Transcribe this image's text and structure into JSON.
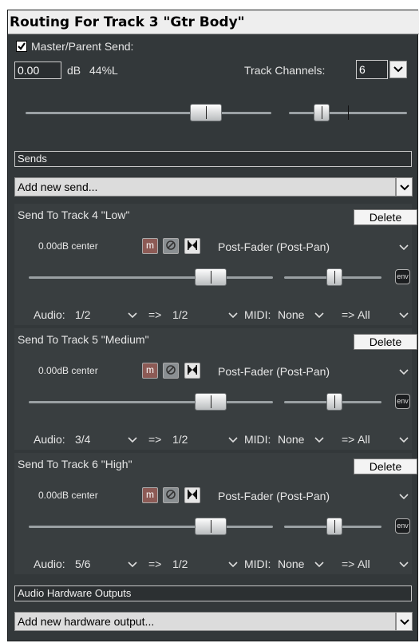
{
  "window": {
    "title": "Routing For Track 3 \"Gtr Body\""
  },
  "master": {
    "checkbox_label": "Master/Parent Send:",
    "checked": true,
    "volume_value": "0.00",
    "volume_unit": "dB",
    "pan_text": "44%L",
    "track_channels_label": "Track Channels:",
    "track_channels_value": "6"
  },
  "sends_section": {
    "header": "Sends",
    "add_new": "Add new send...",
    "sends": [
      {
        "title": "Send To Track 4 \"Low\"",
        "delete_label": "Delete",
        "level_text": "0.00dB center",
        "mode": "Post-Fader (Post-Pan)",
        "audio_label": "Audio:",
        "audio_src": "1/2",
        "arrow": "=>",
        "audio_dst": "1/2",
        "midi_label": "MIDI:",
        "midi_src": "None",
        "midi_dst": "All",
        "env_label": "env",
        "mute_label": "m"
      },
      {
        "title": "Send To Track 5 \"Medium\"",
        "delete_label": "Delete",
        "level_text": "0.00dB center",
        "mode": "Post-Fader (Post-Pan)",
        "audio_label": "Audio:",
        "audio_src": "3/4",
        "arrow": "=>",
        "audio_dst": "1/2",
        "midi_label": "MIDI:",
        "midi_src": "None",
        "midi_dst": "All",
        "env_label": "env",
        "mute_label": "m"
      },
      {
        "title": "Send To Track 6 \"High\"",
        "delete_label": "Delete",
        "level_text": "0.00dB center",
        "mode": "Post-Fader (Post-Pan)",
        "audio_label": "Audio:",
        "audio_src": "5/6",
        "arrow": "=>",
        "audio_dst": "1/2",
        "midi_label": "MIDI:",
        "midi_src": "None",
        "midi_dst": "All",
        "env_label": "env",
        "mute_label": "m"
      }
    ]
  },
  "hw_outputs": {
    "header": "Audio Hardware Outputs",
    "add_new": "Add new hardware output..."
  }
}
